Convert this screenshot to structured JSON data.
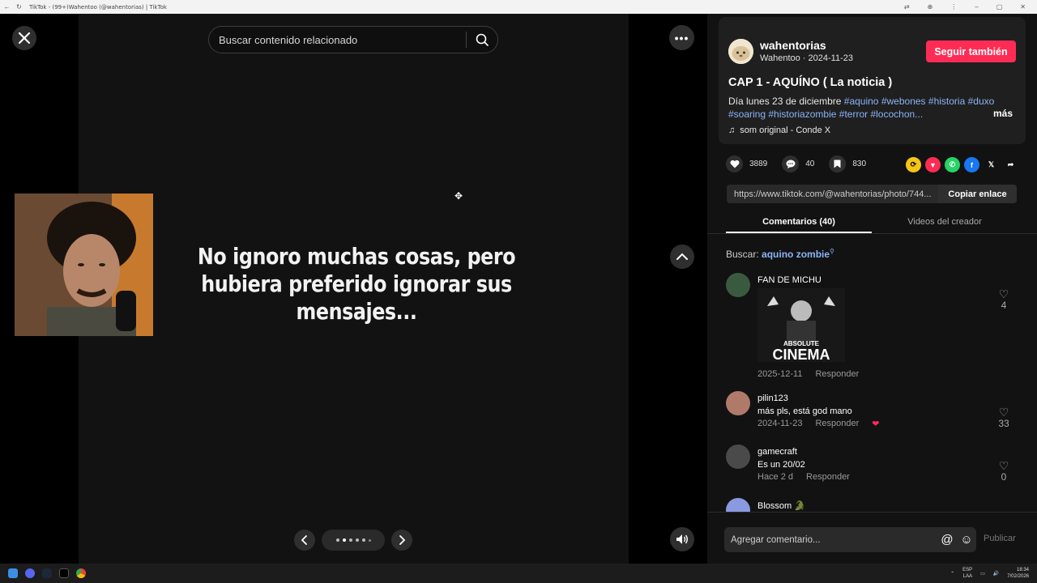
{
  "browser": {
    "tab_title": "TikTok - (99+)Wahentoo (@wahentorias) | TikTok"
  },
  "viewer": {
    "search_placeholder": "Buscar contenido relacionado",
    "slide_text": "No ignoro muchas cosas, pero hubiera preferido ignorar sus mensajes...",
    "more_label": "•••"
  },
  "post": {
    "username": "wahentorias",
    "display_name": "Wahentoo",
    "date": "2024-11-23",
    "follow_label": "Seguir también",
    "title": "CAP 1 - AQUÍNO ( La noticia )",
    "desc_prefix": "Día lunes 23 de diciembre",
    "tags_line1": [
      "#aquino",
      "#webones",
      "#historia",
      "#duxo"
    ],
    "tags_line2": [
      "#soaring",
      "#historiazombie",
      "#terror",
      "#locochon..."
    ],
    "more_label": "más",
    "sound": "som original - Conde X"
  },
  "stats": {
    "likes": "3889",
    "comments": "40",
    "saves": "830"
  },
  "link": {
    "url": "https://www.tiktok.com/@wahentorias/photo/744...",
    "copy_label": "Copiar enlace"
  },
  "tabs": {
    "comments": "Comentarios (40)",
    "creator": "Videos del creador"
  },
  "search_suggestion": {
    "label": "Buscar:",
    "query": "aquino zombie"
  },
  "comments": [
    {
      "user": "FAN DE MICHU",
      "text": "",
      "date": "2025-12-11",
      "reply": "Responder",
      "likes": "4",
      "image_top": "ABSOLUTE",
      "image_bottom": "CINEMA"
    },
    {
      "user": "pilin123",
      "text": "más pls, está god mano",
      "date": "2024-11-23",
      "reply": "Responder",
      "likes": "33"
    },
    {
      "user": "gamecraft",
      "text": "Es un 20/02",
      "date": "Hace 2 d",
      "reply": "Responder",
      "likes": "0"
    },
    {
      "user": "Blossom 🐊",
      "text": "",
      "date": "",
      "reply": "",
      "likes": ""
    }
  ],
  "composer": {
    "placeholder": "Agregar comentario...",
    "publish_label": "Publicar"
  },
  "taskbar": {
    "lang": "ESP",
    "lang2": "LAA",
    "time": "18:34",
    "date": "7/02/2026"
  },
  "colors": {
    "accent": "#fe2c55",
    "hashtag": "#8ab4f8",
    "panel_bg": "#121212"
  }
}
